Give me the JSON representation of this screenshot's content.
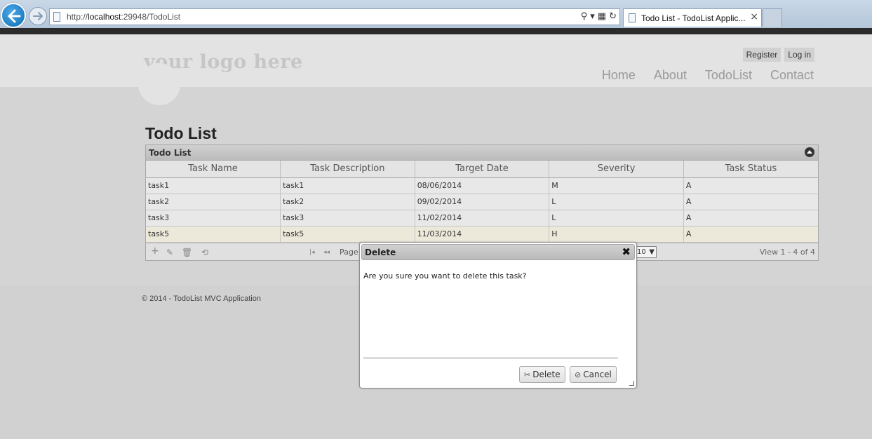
{
  "browser": {
    "url_prefix": "http://",
    "url_host": "localhost",
    "url_rest": ":29948/TodoList",
    "tab_title": "Todo List - TodoList Applic...",
    "tab_close": "×"
  },
  "header": {
    "logo": "your logo here",
    "auth_links": [
      "Register",
      "Log in"
    ],
    "nav": [
      "Home",
      "About",
      "TodoList",
      "Contact"
    ]
  },
  "main": {
    "title": "Todo List",
    "grid": {
      "caption": "Todo List",
      "columns": [
        "Task Name",
        "Task Description",
        "Target Date",
        "Severity",
        "Task Status"
      ],
      "rows": [
        [
          "task1",
          "task1",
          "08/06/2014",
          "M",
          "A"
        ],
        [
          "task2",
          "task2",
          "09/02/2014",
          "L",
          "A"
        ],
        [
          "task3",
          "task3",
          "11/02/2014",
          "L",
          "A"
        ],
        [
          "task5",
          "task5",
          "11/03/2014",
          "H",
          "A"
        ]
      ],
      "selected_row": 3,
      "pager": {
        "page_label": "Page",
        "rows_per_page": "10",
        "view_text": "View 1 - 4 of 4"
      }
    }
  },
  "footer": {
    "text": "© 2014 - TodoList MVC Application"
  },
  "dialog": {
    "title": "Delete",
    "close_glyph": "✖",
    "message": "Are you sure you want to delete this task?",
    "delete_label": "Delete",
    "cancel_label": "Cancel"
  }
}
